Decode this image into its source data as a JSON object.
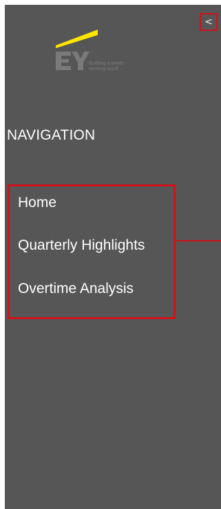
{
  "collapse_button": {
    "label": "<"
  },
  "logo": {
    "mark": "EY",
    "tagline_line1": "Building a better",
    "tagline_line2": "working world"
  },
  "navigation": {
    "heading": "NAVIGATION",
    "items": [
      {
        "label": "Home"
      },
      {
        "label": "Quarterly Highlights"
      },
      {
        "label": "Overtime Analysis"
      }
    ]
  },
  "colors": {
    "panel_background": "#565656",
    "highlight_border": "#d0121b",
    "logo_beam": "#ffe600",
    "text": "#ffffff"
  }
}
